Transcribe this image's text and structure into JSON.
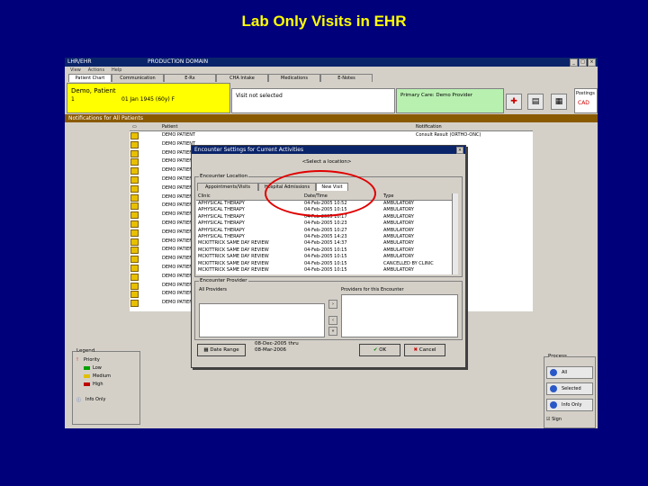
{
  "slide": {
    "title": "Lab Only Visits in EHR"
  },
  "app": {
    "title": "LHR/EHR",
    "subtitle": "PRODUCTION DOMAIN",
    "menu": [
      "View",
      "Actions",
      "Help"
    ],
    "tabs": [
      "Patient Chart",
      "Communication",
      "E-Rx",
      "CHA Intake",
      "Medications",
      "E-Notes"
    ],
    "patient": {
      "name": "Demo, Patient",
      "number": "1",
      "dob": "01 Jan 1945 (60y) F"
    },
    "visit_label": "Visit not selected",
    "provider_label": "Primary Care: Demo Provider",
    "postings": {
      "label": "Postings",
      "value": "CAD"
    },
    "notifications_title": "Notifications for All Patients",
    "list": {
      "columns": [
        "Patient",
        "Notification"
      ],
      "rows": [
        {
          "patient": "DEMO PATIENT",
          "note": "Consult Result (ORTHO-ONC)"
        },
        {
          "patient": "DEMO PATIENT",
          "note": ""
        },
        {
          "patient": "DEMO PATIENT",
          "note": ""
        },
        {
          "patient": "DEMO PATIENT",
          "note": ""
        },
        {
          "patient": "DEMO PATIENT",
          "note": ""
        },
        {
          "patient": "DEMO PATIENT",
          "note": ""
        },
        {
          "patient": "DEMO PATIENT",
          "note": ""
        },
        {
          "patient": "DEMO PATIENT",
          "note": ""
        },
        {
          "patient": "DEMO PATIENT",
          "note": ""
        },
        {
          "patient": "DEMO PATIENT",
          "note": ""
        },
        {
          "patient": "DEMO PATIENT",
          "note": ""
        },
        {
          "patient": "DEMO PATIENT",
          "note": ""
        },
        {
          "patient": "DEMO PATIENT",
          "note": ""
        },
        {
          "patient": "DEMO PATIENT",
          "note": ""
        },
        {
          "patient": "DEMO PATIENT",
          "note": ""
        },
        {
          "patient": "DEMO PATIENT",
          "note": ""
        },
        {
          "patient": "DEMO PATIENT",
          "note": ""
        },
        {
          "patient": "DEMO PATIENT",
          "note": ""
        },
        {
          "patient": "DEMO PATIENT",
          "note": ""
        },
        {
          "patient": "DEMO PATIENT",
          "note": ""
        }
      ]
    },
    "legend": {
      "title": "Legend",
      "priority": "Priority",
      "items": [
        {
          "label": "Low",
          "color": "#00a000"
        },
        {
          "label": "Medium",
          "color": "#e0c000"
        },
        {
          "label": "High",
          "color": "#c00000"
        }
      ],
      "info_only": "Info Only"
    },
    "process": {
      "title": "Process",
      "buttons": [
        "All",
        "Selected",
        "Info Only"
      ],
      "checkbox": "Sign"
    }
  },
  "dialog": {
    "title": "Encounter Settings for Current Activities",
    "location_select": "<Select a location>",
    "location_group": "Encounter Location",
    "tabs": [
      "Appointments/Visits",
      "Hospital Admissions",
      "New Visit"
    ],
    "columns": [
      "Clinic",
      "Date/Time",
      "Type"
    ],
    "encounters": [
      {
        "clinic": "APHYSICAL THERAPY",
        "date": "04-Feb-2005 10:52",
        "type": "AMBULATORY"
      },
      {
        "clinic": "APHYSICAL THERAPY",
        "date": "04-Feb-2005 10:15",
        "type": "AMBULATORY"
      },
      {
        "clinic": "APHYSICAL THERAPY",
        "date": "04-Feb-2005 10:17",
        "type": "AMBULATORY"
      },
      {
        "clinic": "APHYSICAL THERAPY",
        "date": "04-Feb-2005 10:23",
        "type": "AMBULATORY"
      },
      {
        "clinic": "APHYSICAL THERAPY",
        "date": "04-Feb-2005 10:27",
        "type": "AMBULATORY"
      },
      {
        "clinic": "APHYSICAL THERAPY",
        "date": "04-Feb-2005 14:23",
        "type": "AMBULATORY"
      },
      {
        "clinic": "MCKITTRICK SAME DAY REVIEW",
        "date": "04-Feb-2005 14:37",
        "type": "AMBULATORY"
      },
      {
        "clinic": "MCKITTRICK SAME DAY REVIEW",
        "date": "04-Feb-2005 10:15",
        "type": "AMBULATORY"
      },
      {
        "clinic": "MCKITTRICK SAME DAY REVIEW",
        "date": "04-Feb-2005 10:15",
        "type": "AMBULATORY"
      },
      {
        "clinic": "MCKITTRICK SAME DAY REVIEW",
        "date": "04-Feb-2005 10:15",
        "type": "CANCELLED BY CLINIC"
      },
      {
        "clinic": "MCKITTRICK SAME DAY REVIEW",
        "date": "04-Feb-2005 10:15",
        "type": "AMBULATORY"
      }
    ],
    "provider_group": "Encounter Provider",
    "all_providers_label": "All Providers",
    "providers_for_encounter_label": "Providers for this Encounter",
    "date_range_button": "Date Range",
    "date_info": [
      "08-Dec-2005 thru",
      "08-Mar-2006"
    ],
    "ok_button": "OK",
    "cancel_button": "Cancel",
    "highlight_color": "#e00000"
  }
}
